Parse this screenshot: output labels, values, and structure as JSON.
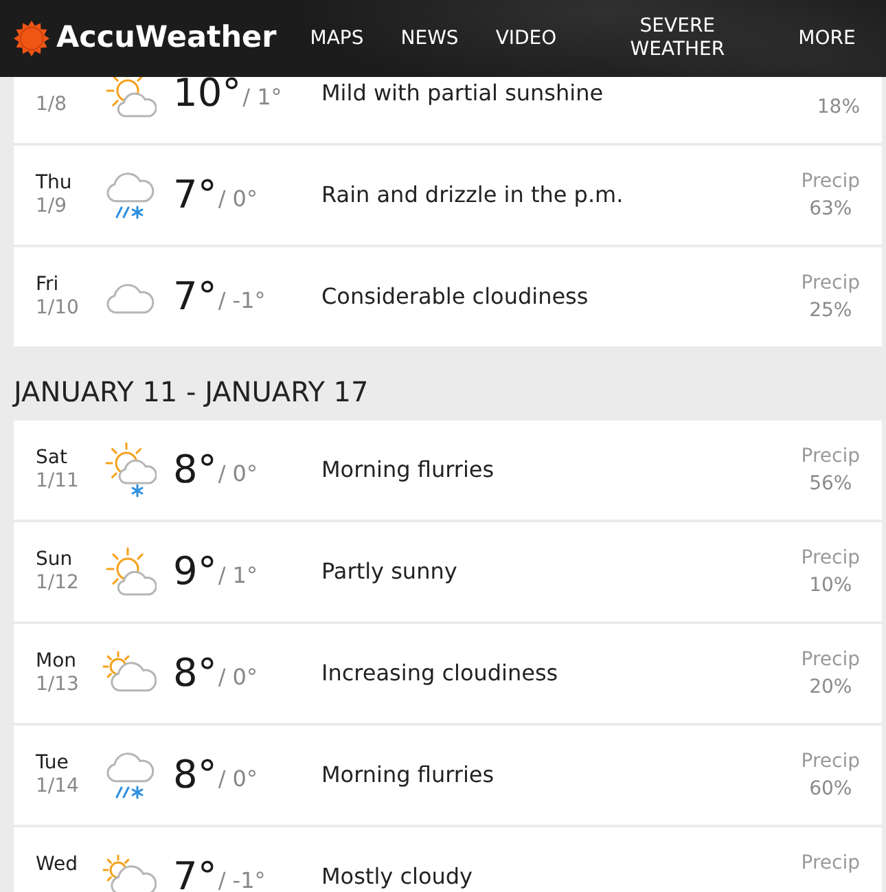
{
  "header": {
    "brand": "AccuWeather",
    "nav": [
      "MAPS",
      "NEWS",
      "VIDEO",
      "SEVERE WEATHER",
      "MORE"
    ]
  },
  "sections": [
    {
      "days": [
        {
          "date": "1/8",
          "kind": "partly-sunny",
          "high": "10°",
          "low": "/ 1°",
          "phrase": "Mild with partial sunshine",
          "precip": "18%"
        },
        {
          "day": "Thu",
          "date": "1/9",
          "kind": "rain-snow",
          "high": "7°",
          "low": "/ 0°",
          "phrase": "Rain and drizzle in the p.m.",
          "precip_label": "Precip",
          "precip": "63%"
        },
        {
          "day": "Fri",
          "date": "1/10",
          "kind": "cloudy",
          "high": "7°",
          "low": "/ -1°",
          "phrase": "Considerable cloudiness",
          "precip_label": "Precip",
          "precip": "25%"
        }
      ]
    },
    {
      "heading": "JANUARY 11 - JANUARY 17",
      "days": [
        {
          "day": "Sat",
          "date": "1/11",
          "kind": "flurries-sun",
          "high": "8°",
          "low": "/ 0°",
          "phrase": "Morning flurries",
          "precip_label": "Precip",
          "precip": "56%"
        },
        {
          "day": "Sun",
          "date": "1/12",
          "kind": "partly-sunny",
          "high": "9°",
          "low": "/ 1°",
          "phrase": "Partly sunny",
          "precip_label": "Precip",
          "precip": "10%"
        },
        {
          "day": "Mon",
          "date": "1/13",
          "kind": "mostly-cloudy",
          "high": "8°",
          "low": "/ 0°",
          "phrase": "Increasing cloudiness",
          "precip_label": "Precip",
          "precip": "20%"
        },
        {
          "day": "Tue",
          "date": "1/14",
          "kind": "rain-snow",
          "high": "8°",
          "low": "/ 0°",
          "phrase": "Morning flurries",
          "precip_label": "Precip",
          "precip": "60%"
        },
        {
          "day": "Wed",
          "kind": "mostly-cloudy",
          "high": "7°",
          "low": "/ -1°",
          "phrase": "Mostly cloudy",
          "precip_label": "Precip"
        }
      ]
    }
  ]
}
